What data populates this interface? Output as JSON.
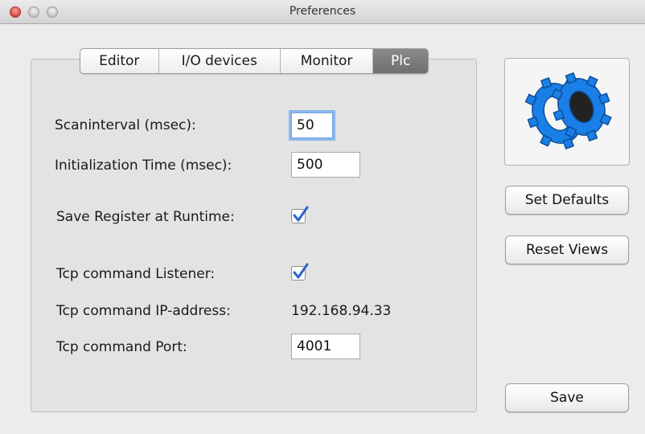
{
  "window": {
    "title": "Preferences"
  },
  "tabs": [
    {
      "label": "Editor",
      "active": false
    },
    {
      "label": "I/O devices",
      "active": false
    },
    {
      "label": "Monitor",
      "active": false
    },
    {
      "label": "Plc",
      "active": true
    }
  ],
  "plc": {
    "scaninterval": {
      "label": "Scaninterval (msec):",
      "value": "50"
    },
    "init_time": {
      "label": "Initialization Time (msec):",
      "value": "500"
    },
    "save_register": {
      "label": "Save Register at Runtime:",
      "checked": true
    },
    "tcp_listener": {
      "label": "Tcp command Listener:",
      "checked": true
    },
    "tcp_ip": {
      "label": "Tcp command IP-address:",
      "value": "192.168.94.33"
    },
    "tcp_port": {
      "label": "Tcp command Port:",
      "value": "4001"
    }
  },
  "buttons": {
    "set_defaults": "Set Defaults",
    "reset_views": "Reset Views",
    "save": "Save"
  },
  "icon": {
    "name": "gears-icon",
    "color": "#1a7fe6"
  },
  "colors": {
    "accent": "#2a64c8",
    "focus_ring": "#8ab8ee"
  }
}
